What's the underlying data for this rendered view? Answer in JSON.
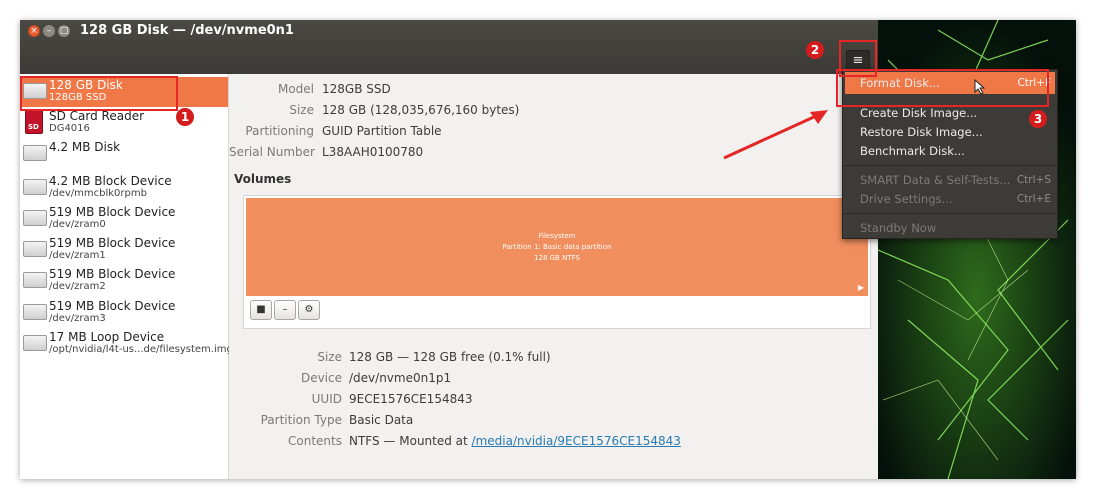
{
  "window": {
    "title": "128 GB Disk — /dev/nvme0n1",
    "close_glyph": "×",
    "min_glyph": "–",
    "max_glyph": "□"
  },
  "menu_button_icon": "≡",
  "sidebar": {
    "items": [
      {
        "name": "128 GB Disk",
        "sub": "128GB SSD",
        "icon": "disk-icon",
        "selected": true
      },
      {
        "name": "SD Card Reader",
        "sub": "DG4016",
        "icon": "sd-card-icon",
        "icon_text": "SD"
      },
      {
        "name": "4.2 MB Disk",
        "sub": "",
        "icon": "disk-icon"
      },
      {
        "name": "4.2 MB Block Device",
        "sub": "/dev/mmcblk0rpmb",
        "icon": "drive-icon"
      },
      {
        "name": "519 MB Block Device",
        "sub": "/dev/zram0",
        "icon": "drive-icon"
      },
      {
        "name": "519 MB Block Device",
        "sub": "/dev/zram1",
        "icon": "drive-icon"
      },
      {
        "name": "519 MB Block Device",
        "sub": "/dev/zram2",
        "icon": "drive-icon"
      },
      {
        "name": "519 MB Block Device",
        "sub": "/dev/zram3",
        "icon": "drive-icon"
      },
      {
        "name": "17 MB Loop Device",
        "sub": "/opt/nvidia/l4t-us...de/filesystem.img",
        "icon": "drive-icon"
      }
    ]
  },
  "disk_info": {
    "model_label": "Model",
    "model": "128GB SSD",
    "size_label": "Size",
    "size": "128 GB (128,035,676,160 bytes)",
    "partitioning_label": "Partitioning",
    "partitioning": "GUID Partition Table",
    "serial_label": "Serial Number",
    "serial": "L38AAH0100780"
  },
  "volumes": {
    "title": "Volumes",
    "partition_lines": [
      "Filesystem",
      "Partition 1: Basic data partition",
      "128 GB NTFS"
    ],
    "tools": {
      "stop": "■",
      "minus": "–",
      "gear": "⚙"
    }
  },
  "partition_info": {
    "size_label": "Size",
    "size": "128 GB — 128 GB free (0.1% full)",
    "device_label": "Device",
    "device": "/dev/nvme0n1p1",
    "uuid_label": "UUID",
    "uuid": "9ECE1576CE154843",
    "type_label": "Partition Type",
    "type": "Basic Data",
    "contents_label": "Contents",
    "contents_prefix": "NTFS — Mounted at ",
    "contents_link": "/media/nvidia/9ECE1576CE154843"
  },
  "menu": {
    "items": [
      {
        "label": "Format Disk...",
        "accel": "Ctrl+F",
        "highlighted": true
      },
      {
        "label": "Create Disk Image...",
        "accel": ""
      },
      {
        "label": "Restore Disk Image...",
        "accel": ""
      },
      {
        "label": "Benchmark Disk...",
        "accel": ""
      },
      {
        "label": "SMART Data & Self-Tests...",
        "accel": "Ctrl+S",
        "disabled": true
      },
      {
        "label": "Drive Settings...",
        "accel": "Ctrl+E",
        "disabled": true
      },
      {
        "label": "Standby Now",
        "accel": "",
        "disabled": true
      }
    ]
  },
  "annotations": {
    "badge1": "1",
    "badge2": "2",
    "badge3": "3",
    "color": "#e52626"
  },
  "colors": {
    "accent": "#f07746",
    "partition": "#f18e5e",
    "menu_bg": "#3c3b37",
    "titlebar": "#3b3a36"
  }
}
